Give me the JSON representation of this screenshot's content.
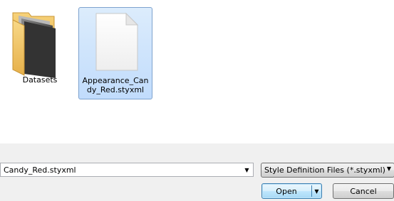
{
  "files": [
    {
      "name": "Datasets",
      "type": "folder-icon"
    },
    {
      "name": "Appearance_Candy_Red.styxml",
      "type": "document-icon"
    }
  ],
  "filename": {
    "value": "Candy_Red.styxml"
  },
  "filetype": {
    "selected": "Style Definition Files (*.styxml)"
  },
  "buttons": {
    "open_label": "Open",
    "cancel_label": "Cancel"
  },
  "colors": {
    "selection_bg": "#dcecfc",
    "selection_border": "#7da2ce",
    "folder": "#f4c15a"
  }
}
